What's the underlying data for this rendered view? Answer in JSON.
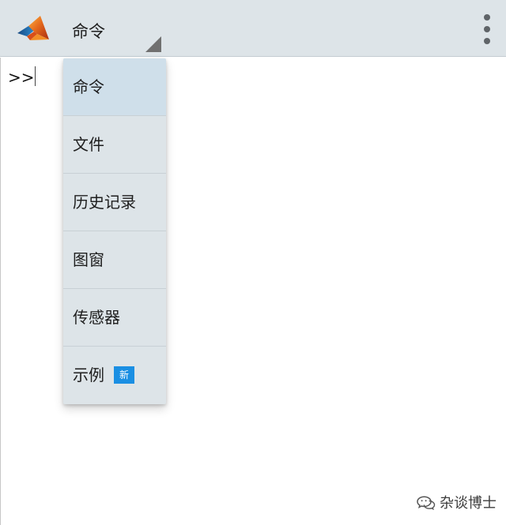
{
  "colors": {
    "appbar_bg": "#dde4e8",
    "menu_bg": "#dde4e8",
    "menu_selected_bg": "#cfdfea",
    "new_badge_bg": "#1a8fe3"
  },
  "header": {
    "logo_icon": "matlab-membrane-logo",
    "current_view": "命令",
    "overflow_icon": "vertical-dots-icon"
  },
  "console": {
    "prompt": ">>"
  },
  "view_menu": {
    "items": [
      {
        "label": "命令",
        "selected": true
      },
      {
        "label": "文件"
      },
      {
        "label": "历史记录"
      },
      {
        "label": "图窗"
      },
      {
        "label": "传感器"
      },
      {
        "label": "示例",
        "badge": "新"
      }
    ]
  },
  "watermark": {
    "icon": "wechat-icon",
    "text": "杂谈博士"
  }
}
